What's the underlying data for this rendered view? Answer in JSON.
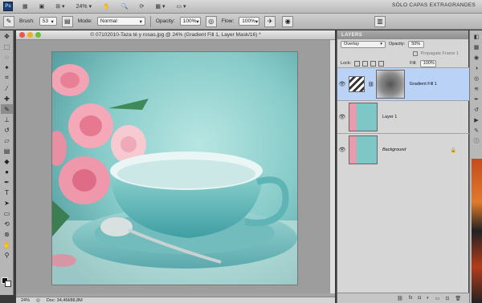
{
  "appbar": {
    "logo": "Ps",
    "zoom": "24%",
    "workspace": "SÓLO CAPAS EXTRAGRANDES"
  },
  "options": {
    "brush_label": "Brush:",
    "brush_size": "53",
    "mode_label": "Mode:",
    "mode_value": "Normal",
    "opacity_label": "Opacity:",
    "opacity_value": "100%",
    "flow_label": "Flow:",
    "flow_value": "100%"
  },
  "document": {
    "title": "© 07102010-Taza té y rosas.jpg @ 24% (Gradient Fill 1, Layer Mask/16) *",
    "status_zoom": "24%",
    "status_doc": "Doc: 34,4M/88,8M"
  },
  "layers_panel": {
    "tab_label": "LAYERS",
    "blend_mode": "Overlay",
    "opacity_label": "Opacity:",
    "opacity_value": "50%",
    "propagate_label": "Propagate Frame 1",
    "lock_label": "Lock:",
    "fill_label": "Fill:",
    "fill_value": "100%",
    "layers": [
      {
        "name": "Gradient Fill 1",
        "selected": true
      },
      {
        "name": "Layer 1",
        "selected": false
      },
      {
        "name": "Background",
        "selected": false
      }
    ]
  },
  "colors": {
    "selection": "#b9d2f5",
    "teal_bg": "#7fc6c6"
  }
}
